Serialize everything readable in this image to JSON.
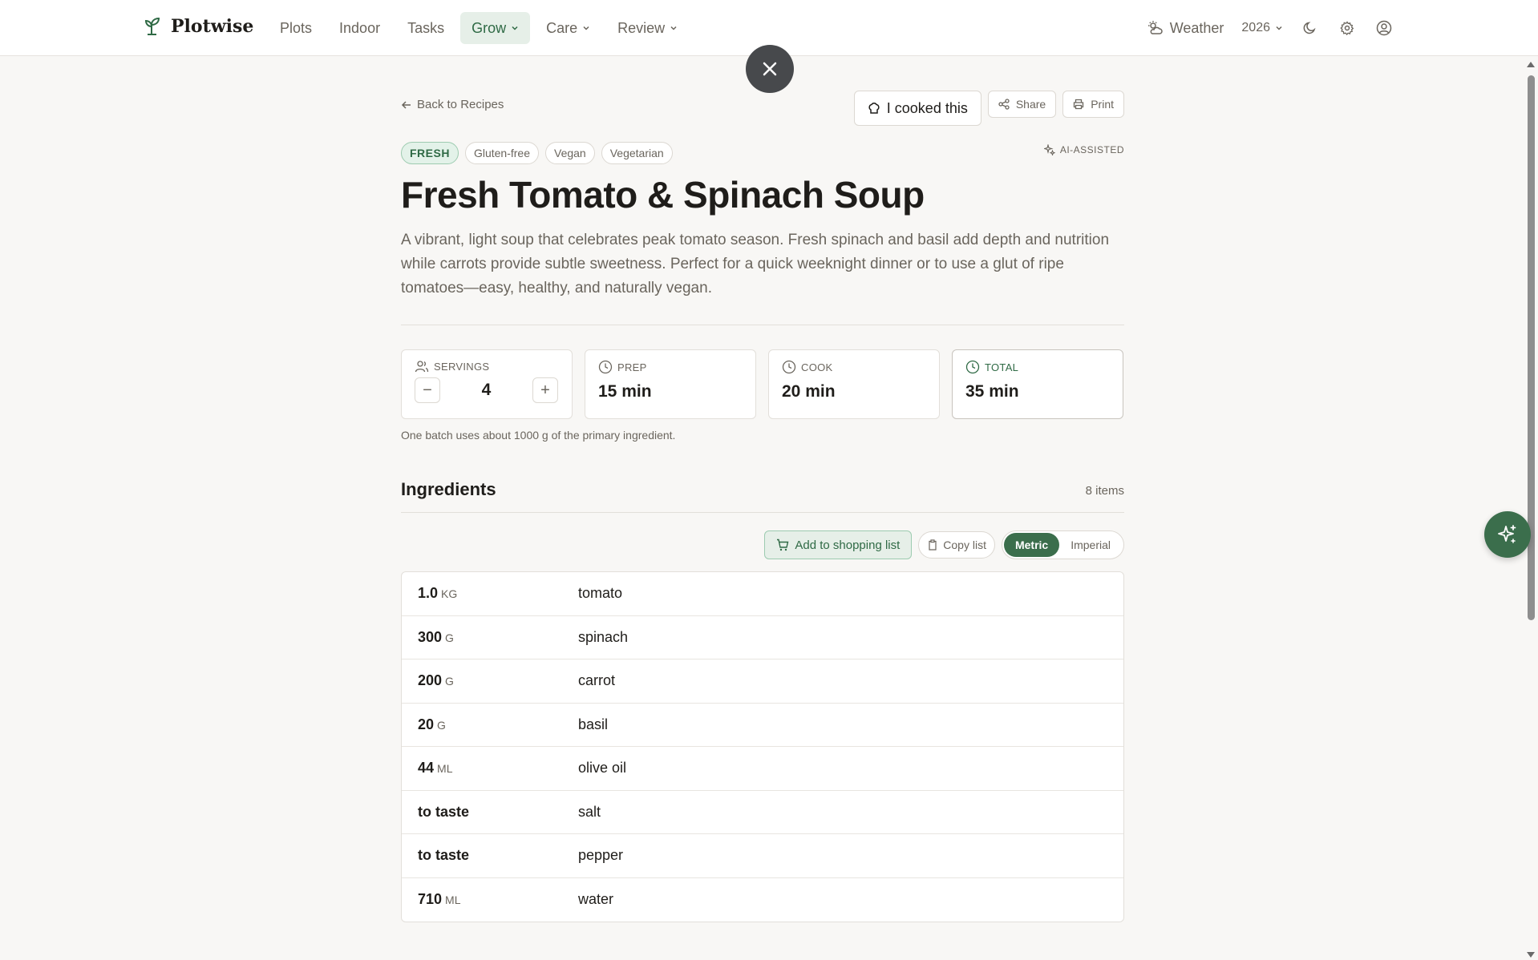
{
  "brand": {
    "name": "Plotwise",
    "icon": "sprout-icon"
  },
  "nav": {
    "items": [
      {
        "label": "Plots",
        "dropdown": false
      },
      {
        "label": "Indoor",
        "dropdown": false
      },
      {
        "label": "Tasks",
        "dropdown": false
      },
      {
        "label": "Grow",
        "dropdown": true,
        "active": true
      },
      {
        "label": "Care",
        "dropdown": true
      },
      {
        "label": "Review",
        "dropdown": true
      }
    ],
    "weather_label": "Weather",
    "year": "2026"
  },
  "recipe": {
    "back_label": "Back to Recipes",
    "cooked_label": "I cooked this",
    "share_label": "Share",
    "print_label": "Print",
    "tags": [
      "FRESH",
      "Gluten-free",
      "Vegan",
      "Vegetarian"
    ],
    "ai_label": "AI-ASSISTED",
    "title": "Fresh Tomato & Spinach Soup",
    "description": "A vibrant, light soup that celebrates peak tomato season. Fresh spinach and basil add depth and nutrition while carrots provide subtle sweetness. Perfect for a quick weeknight dinner or to use a glut of ripe tomatoes—easy, healthy, and naturally vegan.",
    "stats": {
      "servings_label": "SERVINGS",
      "servings": "4",
      "decrement": "−",
      "increment": "+",
      "prep_label": "PREP",
      "prep": "15 min",
      "cook_label": "COOK",
      "cook": "20 min",
      "total_label": "TOTAL",
      "total": "35 min"
    },
    "batch_note": "One batch uses about 1000 g of the primary ingredient."
  },
  "ingredients": {
    "title": "Ingredients",
    "count": "8 items",
    "add_label": "Add to shopping list",
    "copy_label": "Copy list",
    "units": {
      "metric": "Metric",
      "imperial": "Imperial",
      "selected": "Metric"
    },
    "rows": [
      {
        "qty": "1.0",
        "unit": "kg",
        "name": "tomato"
      },
      {
        "qty": "300",
        "unit": "g",
        "name": "spinach"
      },
      {
        "qty": "200",
        "unit": "g",
        "name": "carrot"
      },
      {
        "qty": "20",
        "unit": "g",
        "name": "basil"
      },
      {
        "qty": "44",
        "unit": "ml",
        "name": "olive oil"
      },
      {
        "qty": "to taste",
        "unit": "",
        "name": "salt"
      },
      {
        "qty": "to taste",
        "unit": "",
        "name": "pepper"
      },
      {
        "qty": "710",
        "unit": "ml",
        "name": "water"
      }
    ]
  },
  "colors": {
    "accent": "#3b6e4c",
    "accent_light": "#e6efe8",
    "background": "#f8f7f5"
  }
}
